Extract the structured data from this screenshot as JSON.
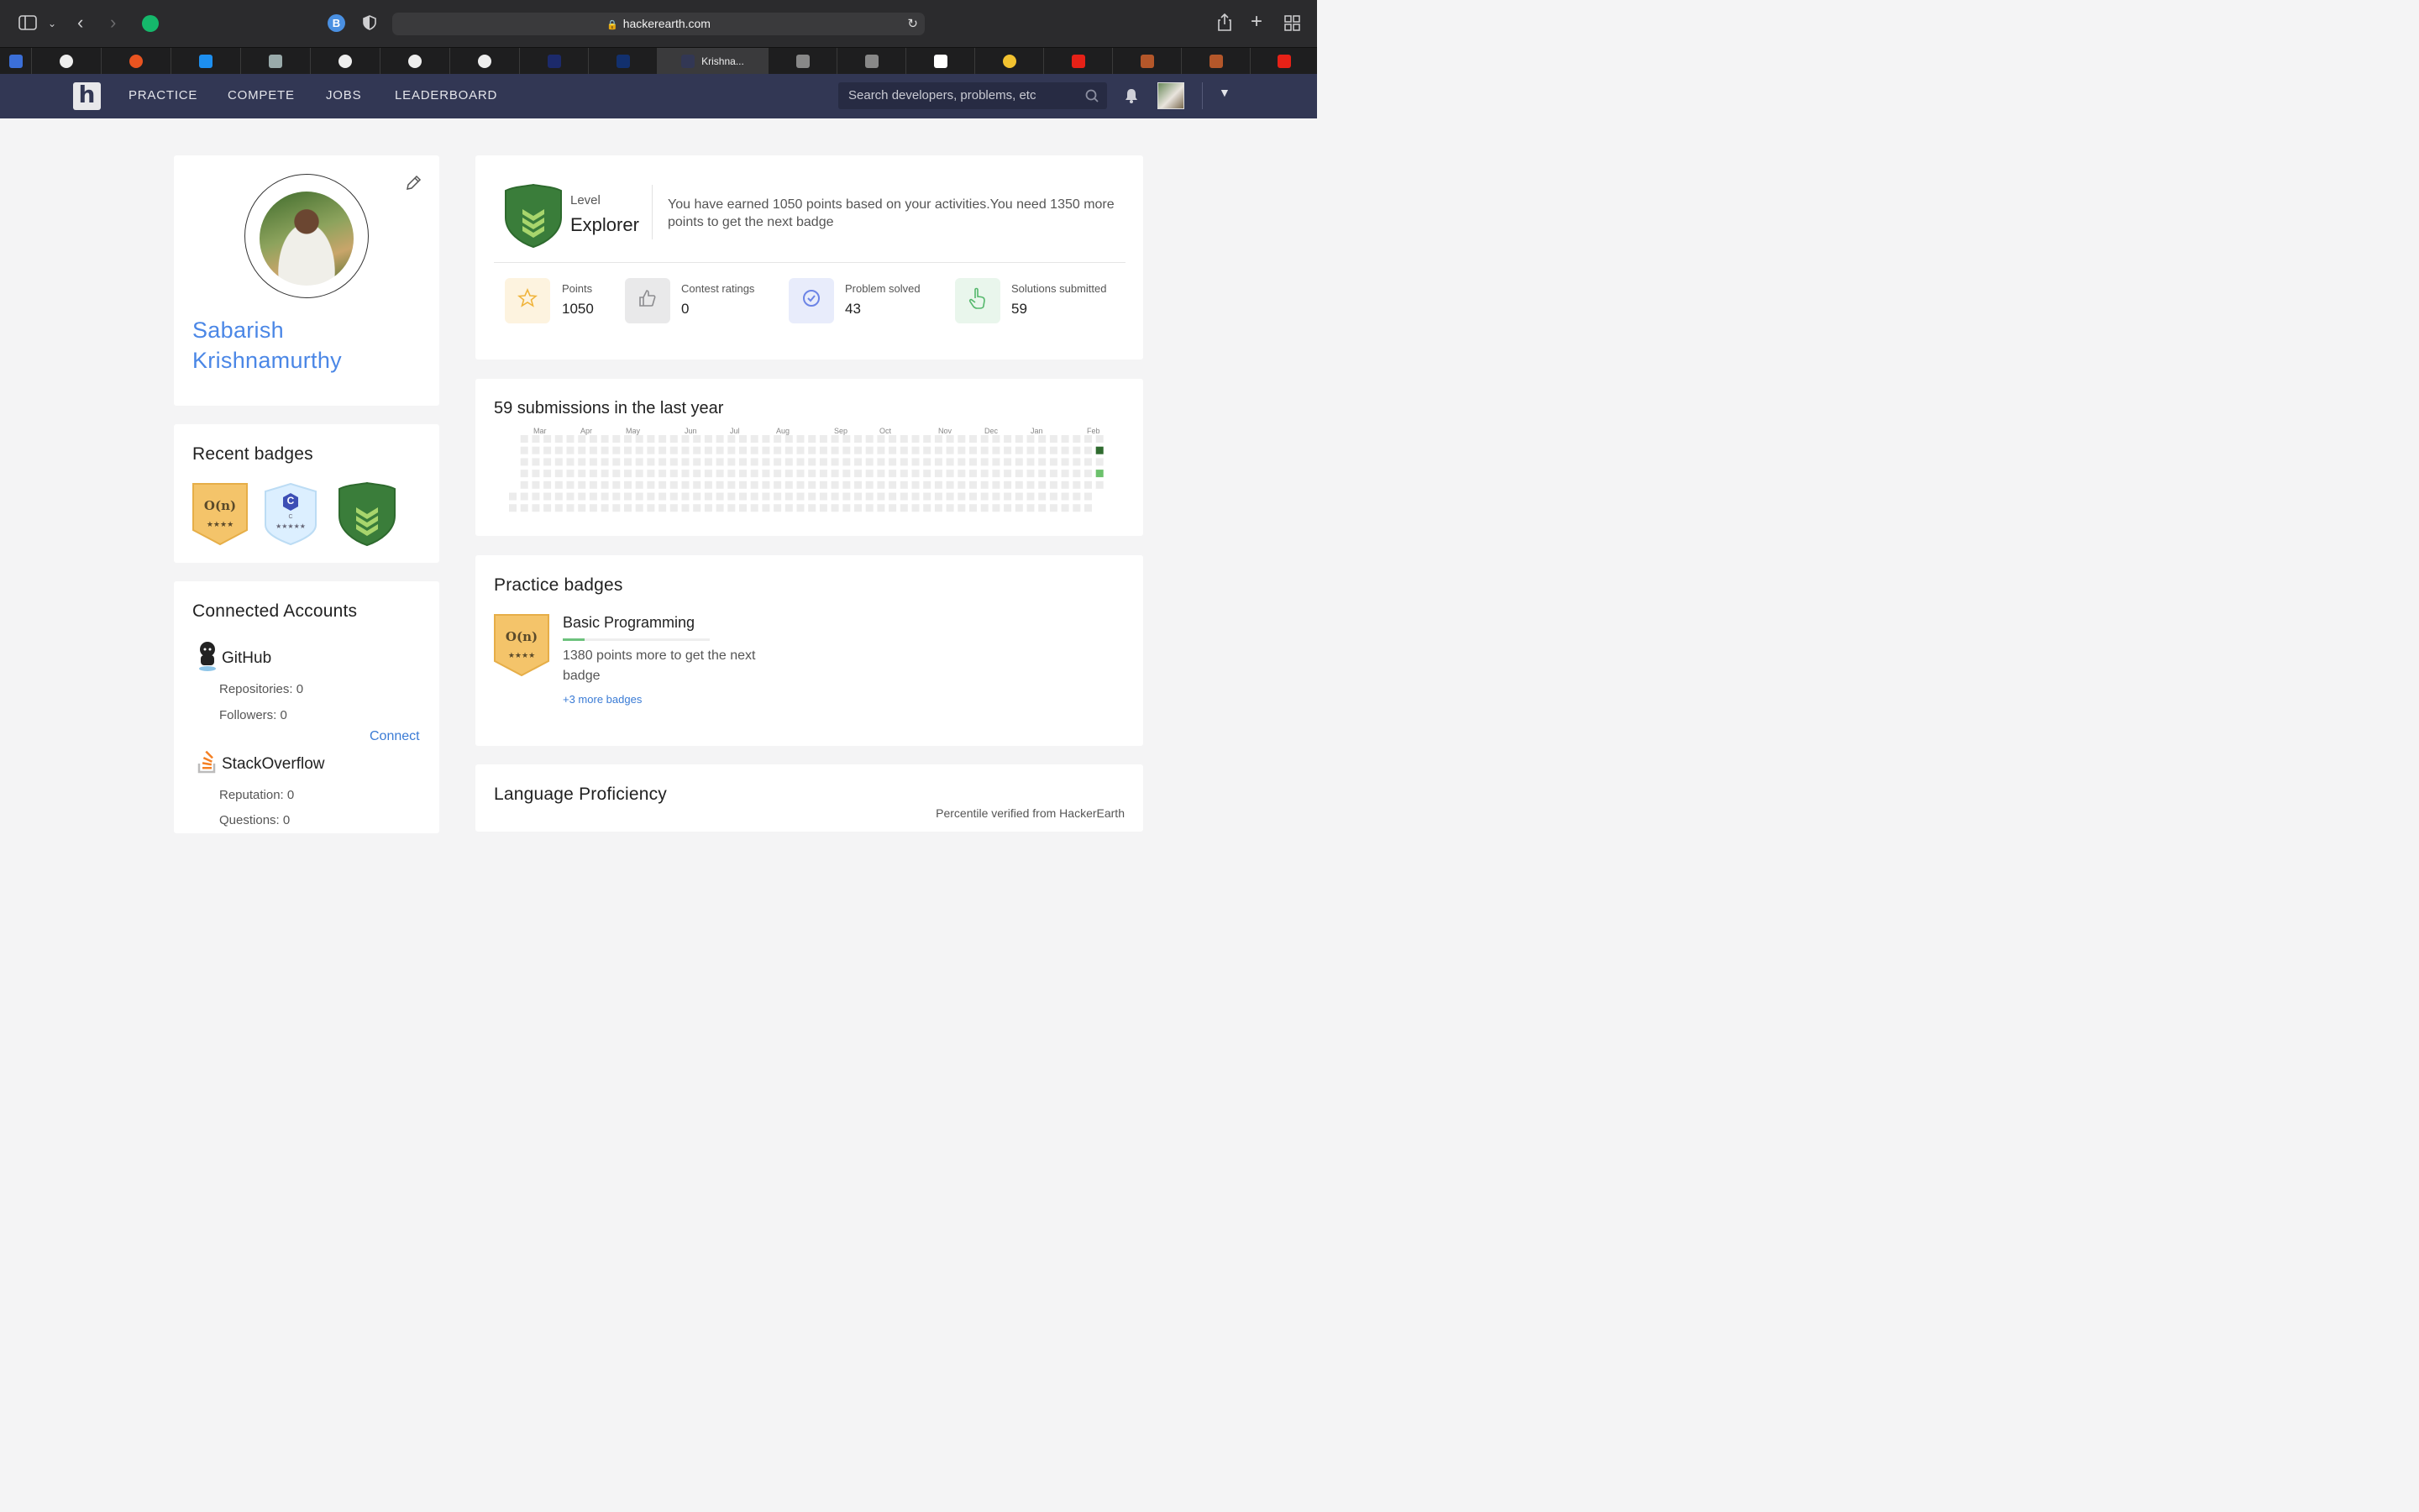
{
  "browser": {
    "url": "hackerearth.com",
    "active_tab_label": "Krishna...",
    "b_badge": "B"
  },
  "nav": {
    "links": [
      "PRACTICE",
      "COMPETE",
      "JOBS",
      "LEADERBOARD"
    ],
    "search_placeholder": "Search developers, problems, etc",
    "logo_letter": "h"
  },
  "profile": {
    "first_name": "Sabarish",
    "last_name": "Krishnamurthy"
  },
  "recent_badges": {
    "title": "Recent badges",
    "items": [
      {
        "glyph": "O(n)",
        "stars": "★★★★"
      },
      {
        "glyph": "C",
        "sub": "C",
        "stars": "★★★★★"
      },
      {
        "glyph": "",
        "stars": ""
      }
    ]
  },
  "accounts": {
    "title": "Connected Accounts",
    "github": {
      "name": "GitHub",
      "repos": "Repositories: 0",
      "followers": "Followers: 0",
      "connect": "Connect"
    },
    "stackoverflow": {
      "name": "StackOverflow",
      "reputation": "Reputation: 0",
      "questions": "Questions: 0"
    }
  },
  "level": {
    "label": "Level",
    "name": "Explorer",
    "message": "You have earned 1050 points based on your activities.You need 1350 more points to get the next badge"
  },
  "stats": [
    {
      "label": "Points",
      "value": "1050",
      "icon": "star-icon",
      "bg": "#fdf3df",
      "color": "#f0b43c"
    },
    {
      "label": "Contest ratings",
      "value": "0",
      "icon": "thumbs-up-icon",
      "bg": "#e9e9ea",
      "color": "#8c8c8f"
    },
    {
      "label": "Problem solved",
      "value": "43",
      "icon": "check-badge-icon",
      "bg": "#e8ecfb",
      "color": "#6c84e6"
    },
    {
      "label": "Solutions submitted",
      "value": "59",
      "icon": "pointer-hand-icon",
      "bg": "#e9f6ec",
      "color": "#55b86c"
    }
  ],
  "submissions": {
    "title": "59 submissions in the last year",
    "months": [
      "Mar",
      "Apr",
      "May",
      "Jun",
      "Jul",
      "Aug",
      "Sep",
      "Oct",
      "Nov",
      "Dec",
      "Jan",
      "Feb"
    ]
  },
  "practice": {
    "title": "Practice badges",
    "badge_name": "Basic Programming",
    "progress": 0.15,
    "message": "1380 points more to get the next badge",
    "more": "+3 more badges",
    "glyph": "O(n)",
    "stars": "★★★★"
  },
  "language": {
    "title": "Language Proficiency",
    "note": "Percentile verified from HackerEarth"
  },
  "colors": {
    "accent": "#4b87e6",
    "nav_bg": "#323754"
  }
}
